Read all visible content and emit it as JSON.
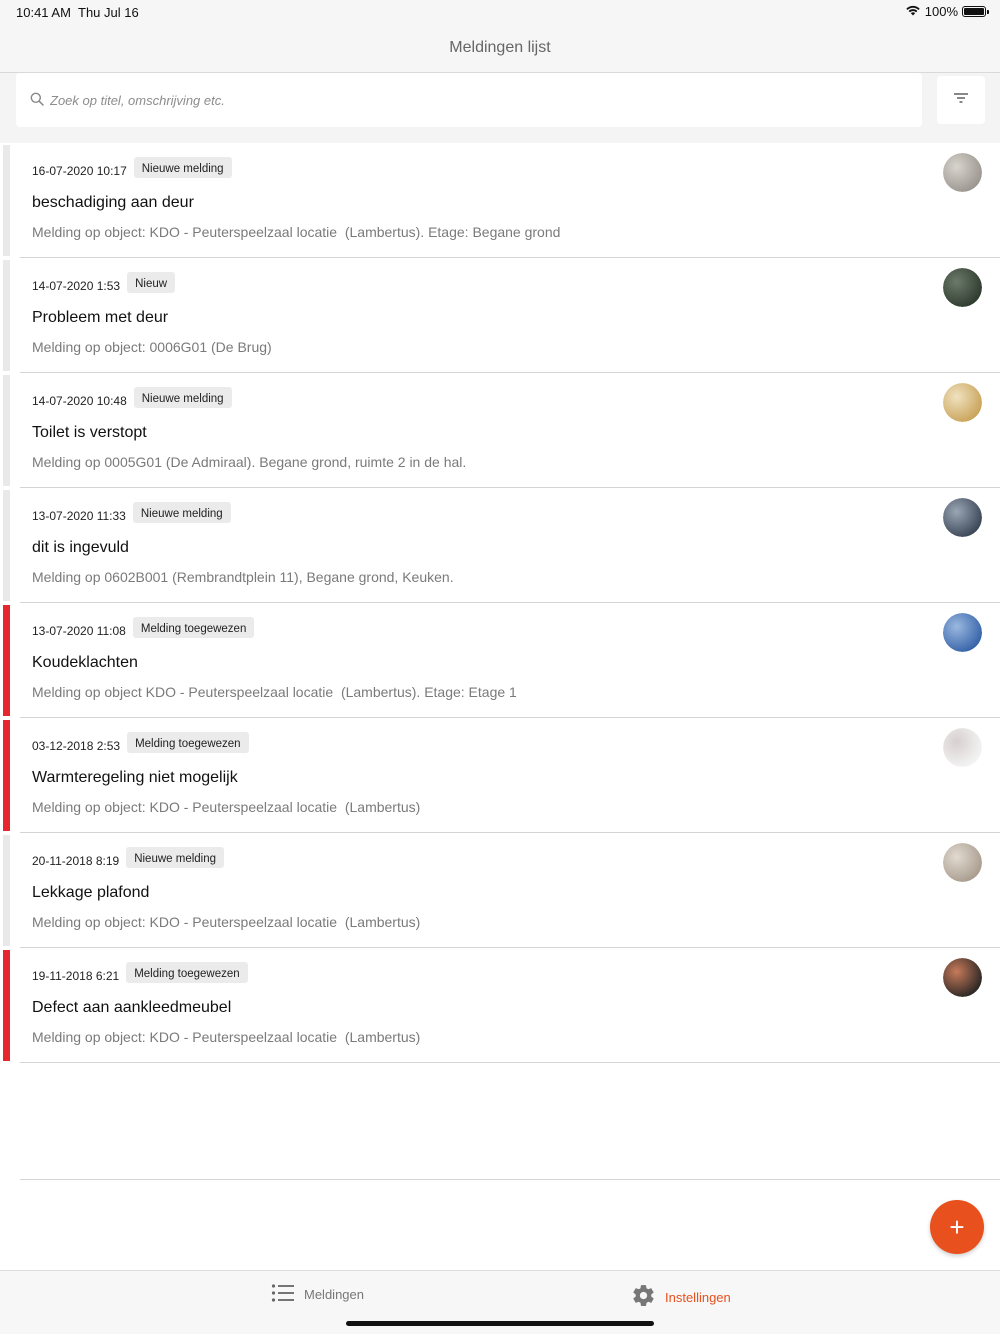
{
  "status_bar": {
    "time": "10:41 AM",
    "date": "Thu Jul 16",
    "battery": "100%",
    "battery_level": 1.0
  },
  "nav": {
    "title": "Meldingen lijst"
  },
  "search": {
    "placeholder": "Zoek op titel, omschrijving etc."
  },
  "list": {
    "items": [
      {
        "date": "16-07-2020 10:17",
        "badge": "Nieuwe melding",
        "title": "beschadiging aan deur",
        "description": "Melding op object: KDO - Peuterspeelzaal locatie  (Lambertus). Etage: Begane grond",
        "status_color": "#e9e9e9"
      },
      {
        "date": "14-07-2020 1:53",
        "badge": "Nieuw",
        "title": "Probleem met deur",
        "description": "Melding op object: 0006G01 (De Brug)",
        "status_color": "#e9e9e9"
      },
      {
        "date": "14-07-2020 10:48",
        "badge": "Nieuwe melding",
        "title": "Toilet is verstopt",
        "description": "Melding op 0005G01 (De Admiraal). Begane grond, ruimte 2 in de hal.",
        "status_color": "#e9e9e9"
      },
      {
        "date": "13-07-2020 11:33",
        "badge": "Nieuwe melding",
        "title": "dit is ingevuld",
        "description": "Melding op 0602B001 (Rembrandtplein 11), Begane grond, Keuken.",
        "status_color": "#e9e9e9"
      },
      {
        "date": "13-07-2020 11:08",
        "badge": "Melding toegewezen",
        "title": "Koudeklachten",
        "description": "Melding op object KDO - Peuterspeelzaal locatie  (Lambertus). Etage: Etage 1",
        "status_color": "#e6282e"
      },
      {
        "date": "03-12-2018 2:53",
        "badge": "Melding toegewezen",
        "title": "Warmteregeling niet mogelijk",
        "description": "Melding op object: KDO - Peuterspeelzaal locatie  (Lambertus)",
        "status_color": "#e6282e"
      },
      {
        "date": "20-11-2018 8:19",
        "badge": "Nieuwe melding",
        "title": "Lekkage plafond",
        "description": "Melding op object: KDO - Peuterspeelzaal locatie  (Lambertus)",
        "status_color": "#e9e9e9"
      },
      {
        "date": "19-11-2018 6:21",
        "badge": "Melding toegewezen",
        "title": "Defect aan aankleedmeubel",
        "description": "Melding op object: KDO - Peuterspeelzaal locatie  (Lambertus)",
        "status_color": "#e6282e"
      }
    ]
  },
  "fab": {
    "label": "+"
  },
  "tabs": {
    "meldingen": "Meldingen",
    "instellingen": "Instellingen"
  },
  "colors": {
    "accent": "#e8501e",
    "assigned": "#e6282e"
  }
}
